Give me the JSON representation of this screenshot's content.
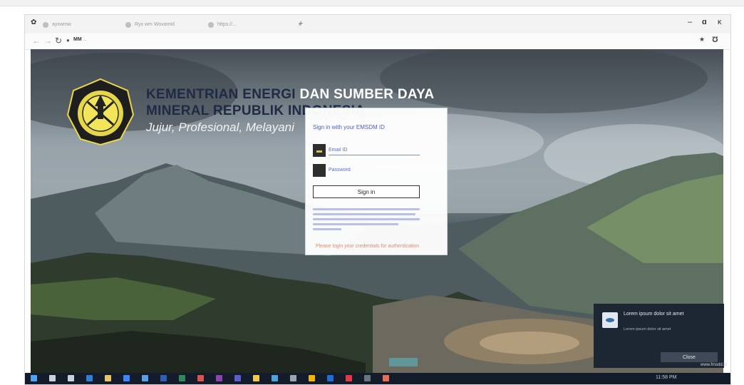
{
  "browser": {
    "tabs": [
      {
        "title": "ayxwmw",
        "active": true
      },
      {
        "title": "Ryx wm Wovamid",
        "active": false
      },
      {
        "title": "https://...",
        "active": false
      }
    ],
    "new_tab_symbol": "+",
    "url_host": "MM",
    "url_path": "...",
    "window_controls": {
      "restore": "ɑ",
      "close": "ĸ"
    }
  },
  "page": {
    "org_line1": "KEMENTRIAN ENERGI",
    "org_line1_highlight": "DAN SUMBER DAYA",
    "org_line2": "MINERAL REPUBLIK INDONESIA",
    "tagline": "Jujur, Profesional, Melayani"
  },
  "login": {
    "heading": "Sign in with your EMSDM ID",
    "email_placeholder": "Email ID",
    "password_placeholder": "Password",
    "signin_label": "Sign in",
    "permission_link": "Please login your credentials for authentication"
  },
  "notification": {
    "title": "Lorem ipsum dolor sit amet",
    "body": "Lorem ipsum dolor sit amet",
    "close_label": "Close"
  },
  "watermark": "www.fmsdd.id",
  "taskbar": {
    "icons": [
      "start",
      "search",
      "task-view",
      "edge",
      "files",
      "store",
      "mail",
      "word",
      "excel",
      "powerpoint",
      "onenote",
      "teams",
      "chrome",
      "photos",
      "settings",
      "explorer",
      "outlook",
      "acrobat",
      "camera",
      "paint"
    ],
    "tray_text": "11:58 PM"
  },
  "colors": {
    "accent_link": "#4a5dd0",
    "title_navy": "#1f2a45",
    "permission": "#e08a6c",
    "taskbar": "#141c2b"
  }
}
